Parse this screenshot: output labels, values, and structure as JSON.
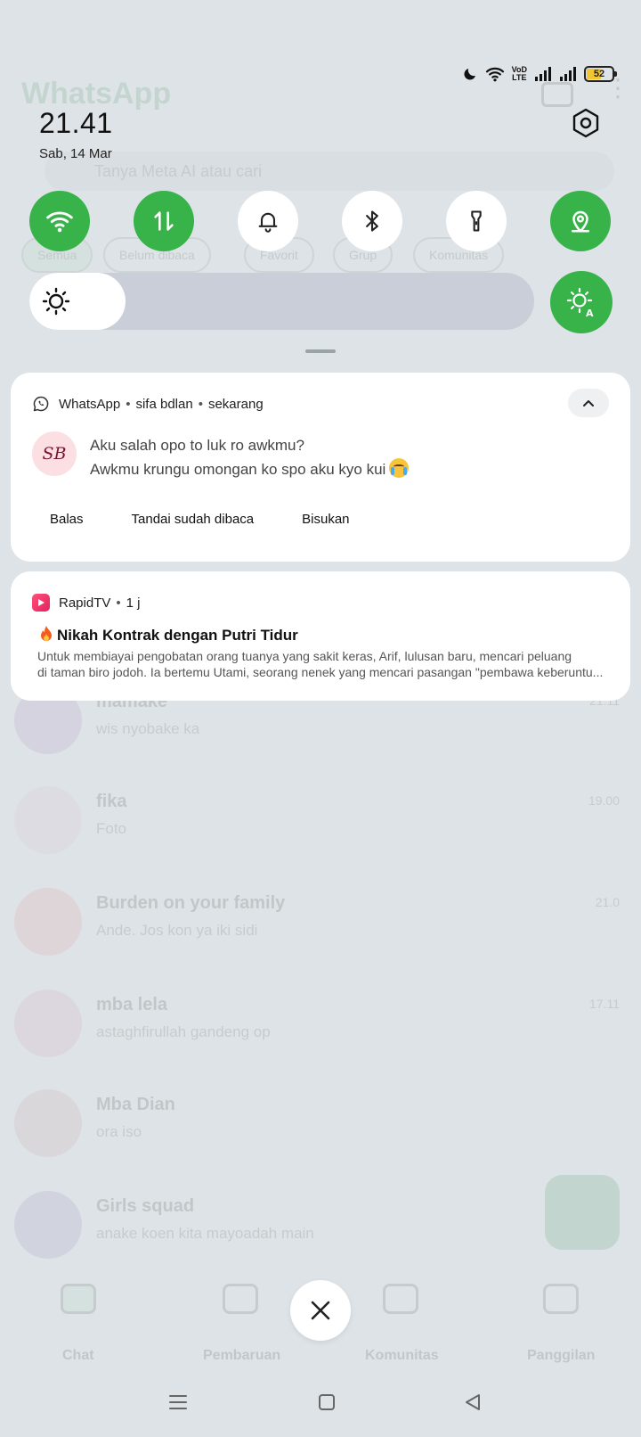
{
  "status_bar": {
    "volte_line1": "VoD",
    "volte_line2": "LTE",
    "battery_level": 52,
    "battery_label": "52",
    "battery_color": "#f2c531"
  },
  "clock": {
    "time": "21.41",
    "date": "Sab, 14 Mar"
  },
  "quick_toggles": [
    {
      "name": "wifi",
      "icon": "wifi-icon",
      "on": true
    },
    {
      "name": "mobile-data",
      "icon": "data-transfer-icon",
      "on": true
    },
    {
      "name": "sound",
      "icon": "bell-icon",
      "on": false
    },
    {
      "name": "bluetooth",
      "icon": "bluetooth-icon",
      "on": false
    },
    {
      "name": "flashlight",
      "icon": "flashlight-icon",
      "on": false
    },
    {
      "name": "location",
      "icon": "location-icon",
      "on": true
    }
  ],
  "brightness": {
    "level": 0.19,
    "auto": true
  },
  "colors": {
    "accent": "#37b34a",
    "panel_bg": "#dde3e6",
    "card_bg": "#ffffff"
  },
  "whatsapp_notification": {
    "app_name": "WhatsApp",
    "sender": "sifa bdlan",
    "time": "sekarang",
    "avatar_initials": "SB",
    "lines": [
      "Aku salah opo to luk ro awkmu?",
      "Awkmu krungu omongan ko spo aku kyo kui"
    ],
    "emoji": "crying-face-icon",
    "actions": [
      "Balas",
      "Tandai sudah dibaca",
      "Bisukan"
    ]
  },
  "rapidtv_notification": {
    "app_name": "RapidTV",
    "time": "1 j",
    "title": "Nikah Kontrak dengan Putri Tidur",
    "body_line1": "Untuk membiayai pengobatan orang tuanya yang sakit keras, Arif, lulusan baru, mencari peluang",
    "body_line2": "di taman biro jodoh. Ia bertemu Utami, seorang nenek yang mencari pasangan \"pembawa keberuntu..."
  },
  "background_app": {
    "title": "WhatsApp",
    "search_placeholder": "Tanya Meta AI atau cari",
    "chips": [
      "Semua",
      "Belum dibaca",
      "Favorit",
      "Grup",
      "Komunitas"
    ],
    "chats": [
      {
        "name": "mamake",
        "message": "wis nyobake ka",
        "time": "21.11"
      },
      {
        "name": "fika",
        "message": "Foto",
        "time": "19.00"
      },
      {
        "name": "Burden on your family",
        "message": "Ande. Jos kon ya iki sidi",
        "time": "21.0"
      },
      {
        "name": "mba lela",
        "message": "astaghfirullah gandeng op",
        "time": "17.11"
      },
      {
        "name": "Mba Dian",
        "message": "ora iso",
        "time": ""
      },
      {
        "name": "Girls squad",
        "message": "anake koen kita mayoadah main",
        "time": ""
      }
    ],
    "tabs": [
      "Chat",
      "Pembaruan",
      "Komunitas",
      "Panggilan"
    ]
  }
}
